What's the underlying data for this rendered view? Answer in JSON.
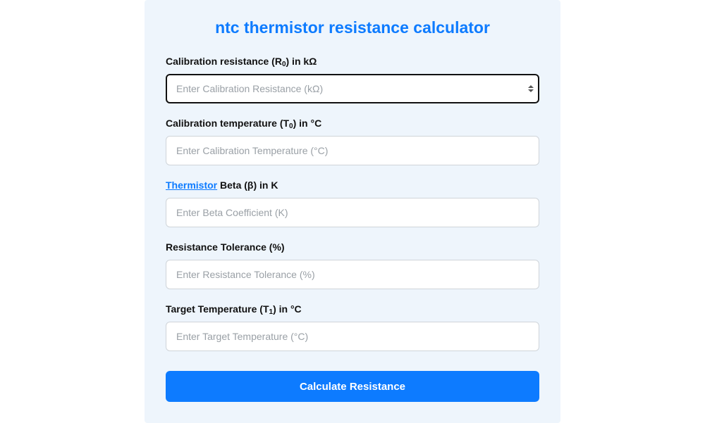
{
  "title": "ntc thermistor resistance calculator",
  "fields": {
    "calib_res": {
      "label_prefix": "Calibration resistance (R",
      "label_sub": "0",
      "label_suffix": ") in kΩ",
      "placeholder": "Enter Calibration Resistance (kΩ)",
      "value": ""
    },
    "calib_temp": {
      "label_prefix": "Calibration temperature (T",
      "label_sub": "0",
      "label_suffix": ") in °C",
      "placeholder": "Enter Calibration Temperature (°C)",
      "value": ""
    },
    "beta": {
      "link_text": "Thermistor",
      "label_rest": " Beta (β) in K",
      "placeholder": "Enter Beta Coefficient (K)",
      "value": ""
    },
    "tolerance": {
      "label": "Resistance Tolerance (%)",
      "placeholder": "Enter Resistance Tolerance (%)",
      "value": ""
    },
    "target_temp": {
      "label_prefix": "Target Temperature (T",
      "label_sub": "1",
      "label_suffix": ") in °C",
      "placeholder": "Enter Target Temperature (°C)",
      "value": ""
    }
  },
  "submit_label": "Calculate Resistance"
}
